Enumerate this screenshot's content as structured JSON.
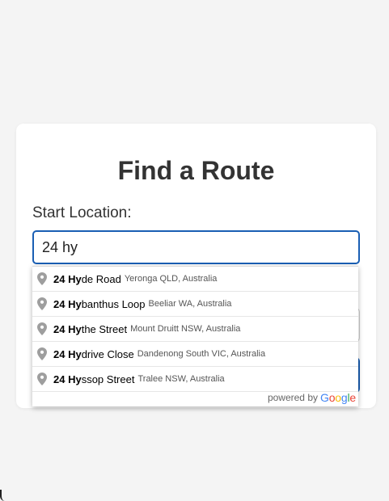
{
  "card": {
    "title": "Find a Route",
    "start_label": "Start Location:",
    "start_value": "24 hy"
  },
  "autocomplete": {
    "items": [
      {
        "match": "24 Hy",
        "rest": "de Road",
        "secondary": "Yeronga QLD, Australia"
      },
      {
        "match": "24 Hy",
        "rest": "banthus Loop",
        "secondary": "Beeliar WA, Australia"
      },
      {
        "match": "24 Hy",
        "rest": "the Street",
        "secondary": "Mount Druitt NSW, Australia"
      },
      {
        "match": "24 Hy",
        "rest": "drive Close",
        "secondary": "Dandenong South VIC, Australia"
      },
      {
        "match": "24 Hy",
        "rest": "ssop Street",
        "secondary": "Tralee NSW, Australia"
      }
    ],
    "powered_by": "powered by",
    "brand_letters": [
      {
        "ch": "G",
        "color": "#4285F4"
      },
      {
        "ch": "o",
        "color": "#EA4335"
      },
      {
        "ch": "o",
        "color": "#FBBC05"
      },
      {
        "ch": "g",
        "color": "#4285F4"
      },
      {
        "ch": "l",
        "color": "#34A853"
      },
      {
        "ch": "e",
        "color": "#EA4335"
      }
    ]
  },
  "colors": {
    "accent": "#1a5fb4",
    "background": "#f4f4f4",
    "pin": "#9e9e9e"
  }
}
